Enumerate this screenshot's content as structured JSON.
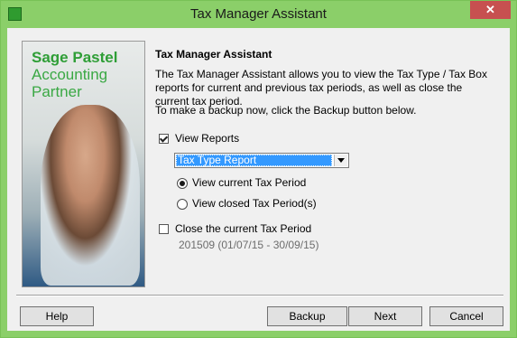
{
  "window": {
    "title": "Tax Manager Assistant",
    "close_glyph": "✕"
  },
  "brand": {
    "line1": "Sage Pastel",
    "line2": "Accounting",
    "line3": "Partner"
  },
  "content": {
    "heading": "Tax Manager Assistant",
    "description": "The Tax Manager Assistant allows you to view the Tax Type / Tax Box reports for current and previous tax periods, as well as close the current tax period.",
    "backup_note": "To make a backup now, click the Backup button below."
  },
  "options": {
    "view_reports": {
      "label": "View Reports",
      "checked": true
    },
    "report_select": {
      "value": "Tax Type Report"
    },
    "radio_current": {
      "label": "View current Tax Period",
      "checked": true
    },
    "radio_closed": {
      "label": "View closed Tax Period(s)",
      "checked": false
    },
    "close_period": {
      "label": "Close the current Tax Period",
      "checked": false
    },
    "period_info": "201509 (01/07/15 - 30/09/15)"
  },
  "buttons": {
    "help": "Help",
    "backup": "Backup",
    "next": "Next",
    "cancel": "Cancel"
  },
  "colors": {
    "title_bar": "#8bcf69",
    "close_button": "#c75050",
    "selection": "#3399ff"
  }
}
